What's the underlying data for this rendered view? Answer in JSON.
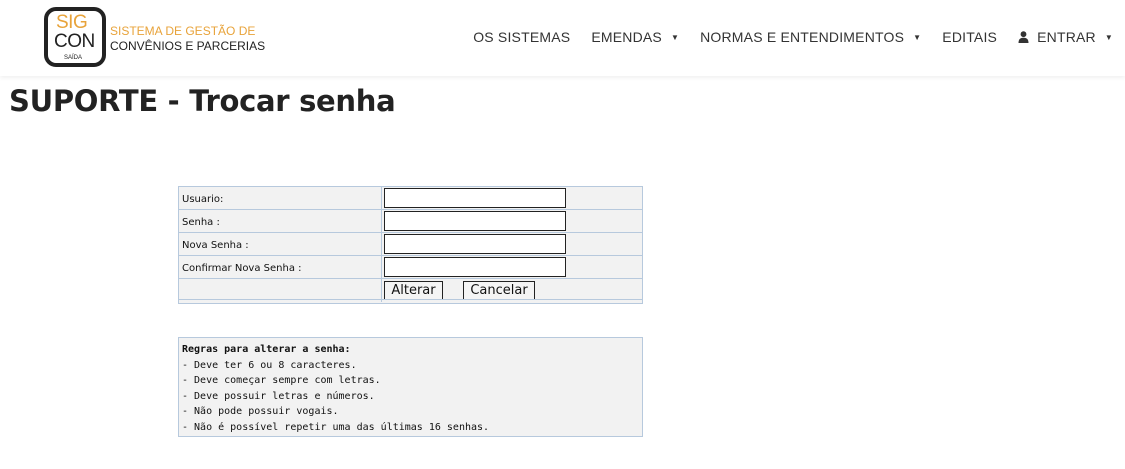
{
  "header": {
    "logo": {
      "sig": "SIG",
      "con": "CON",
      "saida": "SAÍDA",
      "line1": "SISTEMA DE GESTÃO DE",
      "line2": "CONVÊNIOS E PARCERIAS"
    },
    "nav": [
      {
        "label": "OS SISTEMAS"
      },
      {
        "label": "EMENDAS"
      },
      {
        "label": "NORMAS E ENTENDIMENTOS"
      },
      {
        "label": "EDITAIS"
      },
      {
        "label": "ENTRAR"
      }
    ],
    "colors": {
      "accent": "#e8a33a",
      "text": "#333333"
    }
  },
  "page": {
    "title": "SUPORTE - Trocar senha"
  },
  "form": {
    "fields": [
      {
        "label": "Usuario:",
        "value": ""
      },
      {
        "label": "Senha :",
        "value": ""
      },
      {
        "label": "Nova Senha :",
        "value": ""
      },
      {
        "label": "Confirmar Nova Senha :",
        "value": ""
      }
    ],
    "buttons": {
      "submit": "Alterar",
      "cancel": "Cancelar"
    }
  },
  "rules": {
    "title": "Regras para alterar a senha:",
    "items": [
      "- Deve ter 6 ou 8 caracteres.",
      "- Deve começar sempre com letras.",
      "- Deve possuir letras e números.",
      "- Não pode possuir vogais.",
      "- Não é possível repetir uma das últimas 16 senhas."
    ]
  }
}
